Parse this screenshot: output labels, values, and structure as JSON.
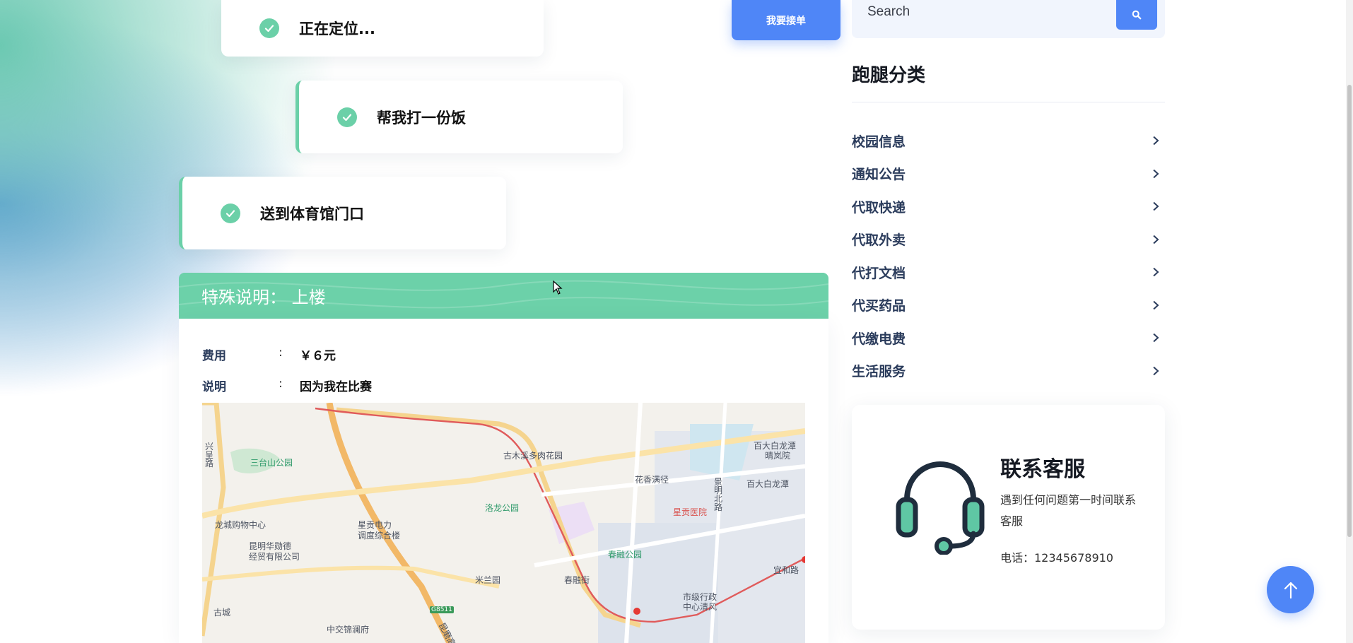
{
  "steps": [
    {
      "label": "正在定位..."
    },
    {
      "label": "帮我打一份饭"
    },
    {
      "label": "送到体育馆门口"
    }
  ],
  "take_order_label": "我要接单",
  "search": {
    "placeholder": "Search"
  },
  "categories": {
    "title": "跑腿分类",
    "items": [
      {
        "label": "校园信息"
      },
      {
        "label": "通知公告"
      },
      {
        "label": "代取快递"
      },
      {
        "label": "代取外卖"
      },
      {
        "label": "代打文档"
      },
      {
        "label": "代买药品"
      },
      {
        "label": "代缴电费"
      },
      {
        "label": "生活服务"
      }
    ]
  },
  "customer_service": {
    "title": "联系客服",
    "description": "遇到任何问题第一时间联系客服",
    "phone": "电话：12345678910"
  },
  "notice": {
    "text": "特殊说明： 上楼"
  },
  "details": {
    "fee_key": "费用",
    "fee_value": "￥６元",
    "note_key": "说明",
    "note_value": "因为我在比赛",
    "colon": ":"
  },
  "map": {
    "pois": [
      {
        "name": "三台山公园",
        "style": "green"
      },
      {
        "name": "古木溪多肉花园",
        "style": "normal"
      },
      {
        "name": "百大白龙潭",
        "style": "normal"
      },
      {
        "name": "晴岚院",
        "style": "normal"
      },
      {
        "name": "花香满径",
        "style": "normal"
      },
      {
        "name": "景明北路",
        "style": "normal"
      },
      {
        "name": "百大白龙潭",
        "style": "normal"
      },
      {
        "name": "洛龙公园",
        "style": "green"
      },
      {
        "name": "星贡医院",
        "style": "red"
      },
      {
        "name": "龙城购物中心",
        "style": "normal"
      },
      {
        "name": "星贡电力",
        "style": "normal"
      },
      {
        "name": "调度综合楼",
        "style": "normal"
      },
      {
        "name": "昆明华勋德",
        "style": "normal"
      },
      {
        "name": "经贸有限公司",
        "style": "normal"
      },
      {
        "name": "春融公园",
        "style": "green"
      },
      {
        "name": "宜和路",
        "style": "normal"
      },
      {
        "name": "米兰园",
        "style": "normal"
      },
      {
        "name": "春融街",
        "style": "normal"
      },
      {
        "name": "市级行政",
        "style": "normal"
      },
      {
        "name": "中心清风",
        "style": "normal"
      },
      {
        "name": "古城",
        "style": "normal"
      },
      {
        "name": "中交锦澜府",
        "style": "normal"
      },
      {
        "name": "兴呈路",
        "style": "normal"
      },
      {
        "name": "G8511",
        "style": "normal"
      },
      {
        "name": "昆磨高速",
        "style": "normal"
      }
    ]
  },
  "colors": {
    "accent_green": "#6bd0a8",
    "accent_blue": "#4f86f7",
    "nav_text": "#2b3c5c"
  },
  "icons": [
    "check-icon",
    "search-icon",
    "chevron-right-icon",
    "headset-icon",
    "arrow-up-icon",
    "cursor-icon"
  ]
}
